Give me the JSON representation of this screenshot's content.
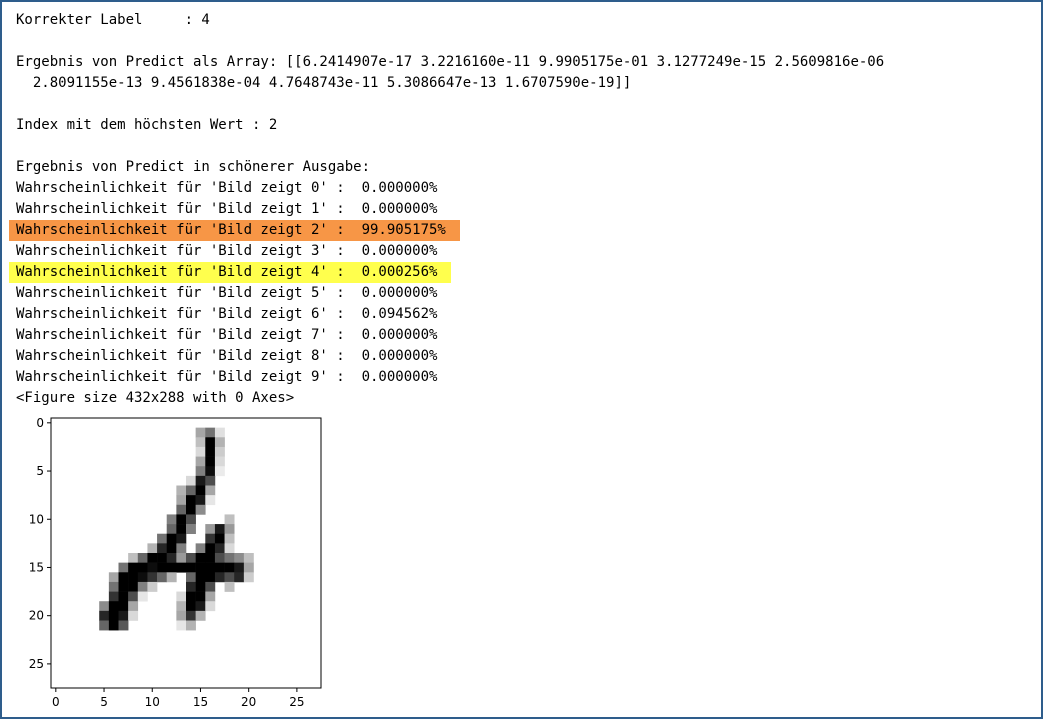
{
  "output": {
    "lines": [
      {
        "text": "Korrekter Label     : 4",
        "hl": null
      },
      {
        "text": "",
        "hl": null
      },
      {
        "text": "Ergebnis von Predict als Array: [[6.2414907e-17 3.2216160e-11 9.9905175e-01 3.1277249e-15 2.5609816e-06",
        "hl": null
      },
      {
        "text": "  2.8091155e-13 9.4561838e-04 4.7648743e-11 5.3086647e-13 1.6707590e-19]]",
        "hl": null
      },
      {
        "text": "",
        "hl": null
      },
      {
        "text": "Index mit dem höchsten Wert : 2",
        "hl": null
      },
      {
        "text": "",
        "hl": null
      },
      {
        "text": "Ergebnis von Predict in schönerer Ausgabe:",
        "hl": null
      },
      {
        "text": "Wahrscheinlichkeit für 'Bild zeigt 0' :  0.000000%",
        "hl": null
      },
      {
        "text": "Wahrscheinlichkeit für 'Bild zeigt 1' :  0.000000%",
        "hl": null
      },
      {
        "text": "Wahrscheinlichkeit für 'Bild zeigt 2' :  99.905175%",
        "hl": "#f79646"
      },
      {
        "text": "Wahrscheinlichkeit für 'Bild zeigt 3' :  0.000000%",
        "hl": null
      },
      {
        "text": "Wahrscheinlichkeit für 'Bild zeigt 4' :  0.000256%",
        "hl": "#ffff4d"
      },
      {
        "text": "Wahrscheinlichkeit für 'Bild zeigt 5' :  0.000000%",
        "hl": null
      },
      {
        "text": "Wahrscheinlichkeit für 'Bild zeigt 6' :  0.094562%",
        "hl": null
      },
      {
        "text": "Wahrscheinlichkeit für 'Bild zeigt 7' :  0.000000%",
        "hl": null
      },
      {
        "text": "Wahrscheinlichkeit für 'Bild zeigt 8' :  0.000000%",
        "hl": null
      },
      {
        "text": "Wahrscheinlichkeit für 'Bild zeigt 9' :  0.000000%",
        "hl": null
      },
      {
        "text": "<Figure size 432x288 with 0 Axes>",
        "hl": null
      }
    ]
  },
  "figure": {
    "x_ticks": [
      "0",
      "5",
      "10",
      "15",
      "20",
      "25"
    ],
    "y_ticks": [
      "0",
      "5",
      "10",
      "15",
      "20",
      "25"
    ],
    "grid_size": 28,
    "colormap": "gray_r",
    "pixels": [
      {
        "r": 1,
        "c": 15,
        "v": 0.35
      },
      {
        "r": 1,
        "c": 16,
        "v": 0.55
      },
      {
        "r": 1,
        "c": 17,
        "v": 0.12
      },
      {
        "r": 2,
        "c": 15,
        "v": 0.25
      },
      {
        "r": 2,
        "c": 16,
        "v": 1.0
      },
      {
        "r": 2,
        "c": 17,
        "v": 0.3
      },
      {
        "r": 3,
        "c": 15,
        "v": 0.15
      },
      {
        "r": 3,
        "c": 16,
        "v": 1.0
      },
      {
        "r": 3,
        "c": 17,
        "v": 0.2
      },
      {
        "r": 4,
        "c": 15,
        "v": 0.35
      },
      {
        "r": 4,
        "c": 16,
        "v": 1.0
      },
      {
        "r": 4,
        "c": 17,
        "v": 0.15
      },
      {
        "r": 5,
        "c": 15,
        "v": 0.5
      },
      {
        "r": 5,
        "c": 16,
        "v": 0.95
      },
      {
        "r": 5,
        "c": 17,
        "v": 0.08
      },
      {
        "r": 6,
        "c": 14,
        "v": 0.15
      },
      {
        "r": 6,
        "c": 15,
        "v": 0.9
      },
      {
        "r": 6,
        "c": 16,
        "v": 0.7
      },
      {
        "r": 7,
        "c": 13,
        "v": 0.3
      },
      {
        "r": 7,
        "c": 14,
        "v": 0.6
      },
      {
        "r": 7,
        "c": 15,
        "v": 1.0
      },
      {
        "r": 7,
        "c": 16,
        "v": 0.35
      },
      {
        "r": 8,
        "c": 13,
        "v": 0.35
      },
      {
        "r": 8,
        "c": 14,
        "v": 1.0
      },
      {
        "r": 8,
        "c": 15,
        "v": 0.9
      },
      {
        "r": 8,
        "c": 16,
        "v": 0.1
      },
      {
        "r": 9,
        "c": 13,
        "v": 0.6
      },
      {
        "r": 9,
        "c": 14,
        "v": 1.0
      },
      {
        "r": 9,
        "c": 15,
        "v": 0.45
      },
      {
        "r": 10,
        "c": 12,
        "v": 0.5
      },
      {
        "r": 10,
        "c": 13,
        "v": 1.0
      },
      {
        "r": 10,
        "c": 14,
        "v": 0.7
      },
      {
        "r": 10,
        "c": 18,
        "v": 0.25
      },
      {
        "r": 11,
        "c": 12,
        "v": 0.6
      },
      {
        "r": 11,
        "c": 13,
        "v": 1.0
      },
      {
        "r": 11,
        "c": 14,
        "v": 0.5
      },
      {
        "r": 11,
        "c": 16,
        "v": 0.4
      },
      {
        "r": 11,
        "c": 17,
        "v": 0.9
      },
      {
        "r": 11,
        "c": 18,
        "v": 0.4
      },
      {
        "r": 12,
        "c": 11,
        "v": 0.55
      },
      {
        "r": 12,
        "c": 12,
        "v": 1.0
      },
      {
        "r": 12,
        "c": 13,
        "v": 0.9
      },
      {
        "r": 12,
        "c": 16,
        "v": 0.8
      },
      {
        "r": 12,
        "c": 17,
        "v": 1.0
      },
      {
        "r": 12,
        "c": 18,
        "v": 0.25
      },
      {
        "r": 13,
        "c": 10,
        "v": 0.3
      },
      {
        "r": 13,
        "c": 11,
        "v": 0.85
      },
      {
        "r": 13,
        "c": 12,
        "v": 1.0
      },
      {
        "r": 13,
        "c": 13,
        "v": 0.5
      },
      {
        "r": 13,
        "c": 15,
        "v": 0.5
      },
      {
        "r": 13,
        "c": 16,
        "v": 1.0
      },
      {
        "r": 13,
        "c": 17,
        "v": 0.85
      },
      {
        "r": 13,
        "c": 18,
        "v": 0.15
      },
      {
        "r": 14,
        "c": 8,
        "v": 0.25
      },
      {
        "r": 14,
        "c": 9,
        "v": 0.6
      },
      {
        "r": 14,
        "c": 10,
        "v": 1.0
      },
      {
        "r": 14,
        "c": 11,
        "v": 1.0
      },
      {
        "r": 14,
        "c": 12,
        "v": 0.85
      },
      {
        "r": 14,
        "c": 13,
        "v": 0.4
      },
      {
        "r": 14,
        "c": 14,
        "v": 0.7
      },
      {
        "r": 14,
        "c": 15,
        "v": 1.0
      },
      {
        "r": 14,
        "c": 16,
        "v": 1.0
      },
      {
        "r": 14,
        "c": 17,
        "v": 0.7
      },
      {
        "r": 14,
        "c": 18,
        "v": 0.55
      },
      {
        "r": 14,
        "c": 19,
        "v": 0.45
      },
      {
        "r": 14,
        "c": 20,
        "v": 0.25
      },
      {
        "r": 15,
        "c": 7,
        "v": 0.55
      },
      {
        "r": 15,
        "c": 8,
        "v": 1.0
      },
      {
        "r": 15,
        "c": 9,
        "v": 1.0
      },
      {
        "r": 15,
        "c": 10,
        "v": 0.95
      },
      {
        "r": 15,
        "c": 11,
        "v": 1.0
      },
      {
        "r": 15,
        "c": 12,
        "v": 1.0
      },
      {
        "r": 15,
        "c": 13,
        "v": 1.0
      },
      {
        "r": 15,
        "c": 14,
        "v": 1.0
      },
      {
        "r": 15,
        "c": 15,
        "v": 1.0
      },
      {
        "r": 15,
        "c": 16,
        "v": 1.0
      },
      {
        "r": 15,
        "c": 17,
        "v": 1.0
      },
      {
        "r": 15,
        "c": 18,
        "v": 1.0
      },
      {
        "r": 15,
        "c": 19,
        "v": 0.9
      },
      {
        "r": 15,
        "c": 20,
        "v": 0.35
      },
      {
        "r": 16,
        "c": 6,
        "v": 0.35
      },
      {
        "r": 16,
        "c": 7,
        "v": 1.0
      },
      {
        "r": 16,
        "c": 8,
        "v": 1.0
      },
      {
        "r": 16,
        "c": 9,
        "v": 0.95
      },
      {
        "r": 16,
        "c": 10,
        "v": 0.8
      },
      {
        "r": 16,
        "c": 11,
        "v": 0.6
      },
      {
        "r": 16,
        "c": 12,
        "v": 0.3
      },
      {
        "r": 16,
        "c": 14,
        "v": 0.6
      },
      {
        "r": 16,
        "c": 15,
        "v": 1.0
      },
      {
        "r": 16,
        "c": 16,
        "v": 1.0
      },
      {
        "r": 16,
        "c": 17,
        "v": 0.85
      },
      {
        "r": 16,
        "c": 18,
        "v": 0.7
      },
      {
        "r": 16,
        "c": 19,
        "v": 0.85
      },
      {
        "r": 16,
        "c": 20,
        "v": 0.2
      },
      {
        "r": 17,
        "c": 6,
        "v": 0.55
      },
      {
        "r": 17,
        "c": 7,
        "v": 1.0
      },
      {
        "r": 17,
        "c": 8,
        "v": 1.0
      },
      {
        "r": 17,
        "c": 9,
        "v": 0.5
      },
      {
        "r": 17,
        "c": 10,
        "v": 0.2
      },
      {
        "r": 17,
        "c": 14,
        "v": 0.85
      },
      {
        "r": 17,
        "c": 15,
        "v": 1.0
      },
      {
        "r": 17,
        "c": 16,
        "v": 0.7
      },
      {
        "r": 17,
        "c": 18,
        "v": 0.25
      },
      {
        "r": 18,
        "c": 6,
        "v": 0.8
      },
      {
        "r": 18,
        "c": 7,
        "v": 1.0
      },
      {
        "r": 18,
        "c": 8,
        "v": 0.7
      },
      {
        "r": 18,
        "c": 9,
        "v": 0.1
      },
      {
        "r": 18,
        "c": 13,
        "v": 0.15
      },
      {
        "r": 18,
        "c": 14,
        "v": 1.0
      },
      {
        "r": 18,
        "c": 15,
        "v": 1.0
      },
      {
        "r": 18,
        "c": 16,
        "v": 0.35
      },
      {
        "r": 19,
        "c": 5,
        "v": 0.45
      },
      {
        "r": 19,
        "c": 6,
        "v": 1.0
      },
      {
        "r": 19,
        "c": 7,
        "v": 1.0
      },
      {
        "r": 19,
        "c": 8,
        "v": 0.35
      },
      {
        "r": 19,
        "c": 13,
        "v": 0.3
      },
      {
        "r": 19,
        "c": 14,
        "v": 1.0
      },
      {
        "r": 19,
        "c": 15,
        "v": 0.9
      },
      {
        "r": 19,
        "c": 16,
        "v": 0.15
      },
      {
        "r": 20,
        "c": 5,
        "v": 0.85
      },
      {
        "r": 20,
        "c": 6,
        "v": 1.0
      },
      {
        "r": 20,
        "c": 7,
        "v": 0.9
      },
      {
        "r": 20,
        "c": 8,
        "v": 0.15
      },
      {
        "r": 20,
        "c": 13,
        "v": 0.35
      },
      {
        "r": 20,
        "c": 14,
        "v": 0.8
      },
      {
        "r": 20,
        "c": 15,
        "v": 0.3
      },
      {
        "r": 21,
        "c": 5,
        "v": 0.6
      },
      {
        "r": 21,
        "c": 6,
        "v": 1.0
      },
      {
        "r": 21,
        "c": 7,
        "v": 0.65
      },
      {
        "r": 21,
        "c": 13,
        "v": 0.1
      },
      {
        "r": 21,
        "c": 14,
        "v": 0.3
      }
    ]
  }
}
